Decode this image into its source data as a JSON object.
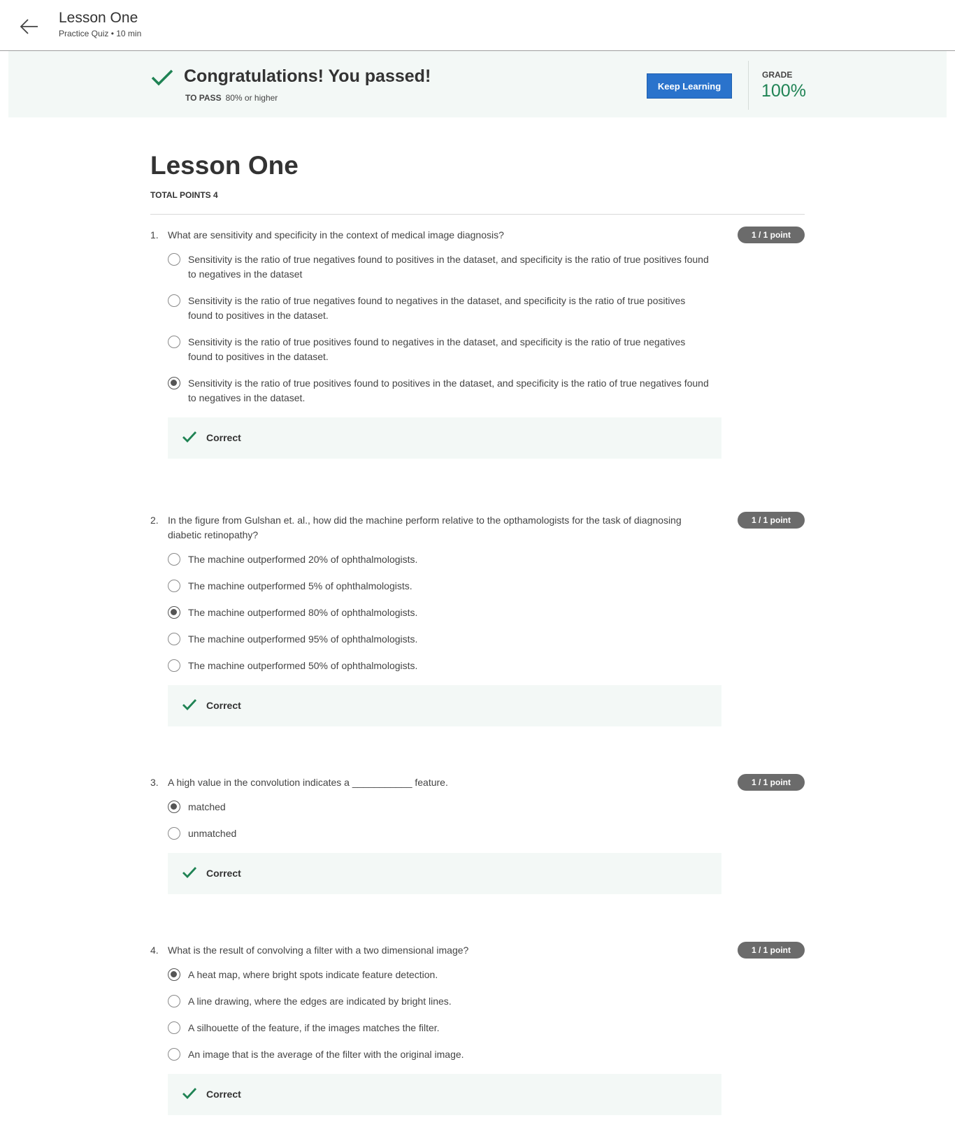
{
  "header": {
    "title": "Lesson One",
    "subtitle": "Practice Quiz • 10 min"
  },
  "banner": {
    "title": "Congratulations! You passed!",
    "to_pass_label": "TO PASS",
    "to_pass_value": "80% or higher",
    "keep_learning": "Keep Learning",
    "grade_label": "GRADE",
    "grade_value": "100%"
  },
  "quiz": {
    "title": "Lesson One",
    "total_points": "TOTAL POINTS 4",
    "questions": [
      {
        "number": "1.",
        "text": "What are sensitivity and specificity in the context of medical image diagnosis?",
        "points": "1 / 1 point",
        "options": [
          "Sensitivity is the ratio of true negatives found to positives in the dataset, and specificity is the ratio of true positives found to negatives in the dataset",
          "Sensitivity is the ratio of true negatives found to negatives in the dataset, and specificity is the ratio of true positives found to positives in the dataset.",
          "Sensitivity is the ratio of true positives found to negatives in the dataset, and specificity is the ratio of true negatives found to positives in the dataset.",
          "Sensitivity is the ratio of true positives found to positives in the dataset, and specificity is the ratio of true negatives found to negatives in the dataset."
        ],
        "selected": 3,
        "feedback": "Correct"
      },
      {
        "number": "2.",
        "text": "In the figure from Gulshan et. al., how did the machine perform relative to the opthamologists for the task of diagnosing diabetic retinopathy?",
        "points": "1 / 1 point",
        "options": [
          "The machine outperformed 20% of ophthalmologists.",
          "The machine outperformed 5% of ophthalmologists.",
          "The machine outperformed 80% of ophthalmologists.",
          "The machine outperformed 95% of ophthalmologists.",
          "The machine outperformed 50% of ophthalmologists."
        ],
        "selected": 2,
        "feedback": "Correct"
      },
      {
        "number": "3.",
        "text": "A high value in the convolution indicates a  ___________ feature.",
        "points": "1 / 1 point",
        "options": [
          "matched",
          "unmatched"
        ],
        "selected": 0,
        "feedback": "Correct"
      },
      {
        "number": "4.",
        "text": "What is the result of convolving a filter with a two dimensional image?",
        "points": "1 / 1 point",
        "options": [
          "A heat map, where bright spots indicate feature detection.",
          "A line drawing, where the edges are indicated by bright lines.",
          "A silhouette of the feature, if the images matches the filter.",
          "An image that is the average of the filter with the original image."
        ],
        "selected": 0,
        "feedback": "Correct"
      }
    ]
  },
  "icons": {
    "back": "arrow-left-icon",
    "check": "checkmark-icon"
  },
  "colors": {
    "accent": "#2a73cc",
    "success": "#1f8354",
    "banner_bg": "#f3f8f6",
    "badge": "#6b6b6b"
  }
}
